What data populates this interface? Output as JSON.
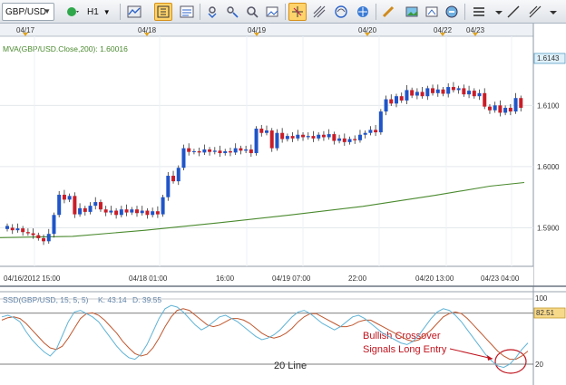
{
  "toolbar": {
    "symbol": "GBP/USD",
    "timeframe": "H1",
    "buttons": [
      "line-chart-icon",
      "bar-chart-icon",
      "candlestick-icon",
      "indicators-icon",
      "magnet-icon",
      "crosshair-icon",
      "cursor-icon",
      "pitchfork-icon",
      "fibonacci-icon",
      "gann-icon",
      "ruler-icon",
      "image-icon",
      "zoom-icon",
      "properties-icon",
      "layout-icon",
      "trend-line-icon",
      "channel-icon"
    ],
    "active_button": "cursor-icon"
  },
  "chart_data": {
    "type": "candlestick",
    "symbol": "GBP/USD",
    "top_date_labels": [
      "04/17",
      "04/18",
      "04/19",
      "04/20",
      "04/22",
      "04/23"
    ],
    "bottom_time_labels": [
      "04/16/2012 15:00",
      "04/18 01:00",
      "16:00",
      "04/19 07:00",
      "22:00",
      "04/20 13:00",
      "04/23 04:00"
    ],
    "price_ticks": [
      "1.6100",
      "1.6000",
      "1.5900"
    ],
    "last_price": "1.6143",
    "ylim": [
      1.584,
      1.621
    ],
    "ma_label": "MVA(GBP/USD.Close,200): 1.60016",
    "ma": [
      [
        0,
        1.5884
      ],
      [
        80,
        1.5886
      ],
      [
        160,
        1.5896
      ],
      [
        240,
        1.5908
      ],
      [
        320,
        1.5921
      ],
      [
        400,
        1.5935
      ],
      [
        480,
        1.5953
      ],
      [
        540,
        1.5968
      ],
      [
        578,
        1.5974
      ]
    ],
    "candles": [
      [
        1.5898,
        1.5903
      ],
      [
        1.59,
        1.5896
      ],
      [
        1.5896,
        1.5899
      ],
      [
        1.5899,
        1.5893
      ],
      [
        1.5893,
        1.5891
      ],
      [
        1.5891,
        1.5888
      ],
      [
        1.5888,
        1.5883
      ],
      [
        1.5883,
        1.5878
      ],
      [
        1.5878,
        1.589
      ],
      [
        1.589,
        1.5921
      ],
      [
        1.5921,
        1.5954
      ],
      [
        1.5954,
        1.5946
      ],
      [
        1.5946,
        1.5952
      ],
      [
        1.5952,
        1.5922
      ],
      [
        1.5922,
        1.5932
      ],
      [
        1.5932,
        1.5926
      ],
      [
        1.5926,
        1.5936
      ],
      [
        1.5936,
        1.5942
      ],
      [
        1.5942,
        1.593
      ],
      [
        1.593,
        1.5925
      ],
      [
        1.5925,
        1.5928
      ],
      [
        1.5928,
        1.5921
      ],
      [
        1.5921,
        1.593
      ],
      [
        1.593,
        1.5925
      ],
      [
        1.5925,
        1.593
      ],
      [
        1.593,
        1.5924
      ],
      [
        1.5924,
        1.5928
      ],
      [
        1.5928,
        1.5921
      ],
      [
        1.5921,
        1.5927
      ],
      [
        1.5927,
        1.5922
      ],
      [
        1.5922,
        1.595
      ],
      [
        1.595,
        1.5985
      ],
      [
        1.5985,
        1.5976
      ],
      [
        1.5976,
        1.5998
      ],
      [
        1.5998,
        1.603
      ],
      [
        1.603,
        1.6024
      ],
      [
        1.6024,
        1.6025
      ],
      [
        1.6025,
        1.6023
      ],
      [
        1.6023,
        1.6028
      ],
      [
        1.6028,
        1.6024
      ],
      [
        1.6024,
        1.6026
      ],
      [
        1.6026,
        1.6022
      ],
      [
        1.6022,
        1.6025
      ],
      [
        1.6025,
        1.6023
      ],
      [
        1.6023,
        1.603
      ],
      [
        1.603,
        1.6026
      ],
      [
        1.6026,
        1.6028
      ],
      [
        1.6028,
        1.6022
      ],
      [
        1.6022,
        1.6062
      ],
      [
        1.6062,
        1.6055
      ],
      [
        1.6055,
        1.6059
      ],
      [
        1.6059,
        1.603
      ],
      [
        1.603,
        1.6055
      ],
      [
        1.6055,
        1.6045
      ],
      [
        1.6045,
        1.605
      ],
      [
        1.605,
        1.6046
      ],
      [
        1.6046,
        1.6052
      ],
      [
        1.6052,
        1.6048
      ],
      [
        1.6048,
        1.605
      ],
      [
        1.605,
        1.6046
      ],
      [
        1.6046,
        1.6052
      ],
      [
        1.6052,
        1.6048
      ],
      [
        1.6048,
        1.6053
      ],
      [
        1.6053,
        1.6042
      ],
      [
        1.6042,
        1.6046
      ],
      [
        1.6046,
        1.604
      ],
      [
        1.604,
        1.6045
      ],
      [
        1.6045,
        1.6043
      ],
      [
        1.6043,
        1.6052
      ],
      [
        1.6052,
        1.6055
      ],
      [
        1.6055,
        1.606
      ],
      [
        1.606,
        1.6056
      ],
      [
        1.6056,
        1.609
      ],
      [
        1.609,
        1.611
      ],
      [
        1.611,
        1.6103
      ],
      [
        1.6103,
        1.6115
      ],
      [
        1.6115,
        1.6108
      ],
      [
        1.6108,
        1.6125
      ],
      [
        1.6125,
        1.6116
      ],
      [
        1.6116,
        1.6122
      ],
      [
        1.6122,
        1.6115
      ],
      [
        1.6115,
        1.6128
      ],
      [
        1.6128,
        1.612
      ],
      [
        1.612,
        1.6126
      ],
      [
        1.6126,
        1.6119
      ],
      [
        1.6119,
        1.613
      ],
      [
        1.613,
        1.6125
      ],
      [
        1.6125,
        1.6128
      ],
      [
        1.6128,
        1.6118
      ],
      [
        1.6118,
        1.6124
      ],
      [
        1.6124,
        1.6115
      ],
      [
        1.6115,
        1.612
      ],
      [
        1.612,
        1.6098
      ],
      [
        1.6098,
        1.6092
      ],
      [
        1.6092,
        1.61
      ],
      [
        1.61,
        1.6088
      ],
      [
        1.6088,
        1.6096
      ],
      [
        1.6096,
        1.609
      ],
      [
        1.609,
        1.6112
      ],
      [
        1.6112,
        1.6096
      ]
    ],
    "indicator": {
      "label": "SSD(GBP/USD, 15, 5, 5)",
      "k_label": "K: 43.14",
      "d_label": "D: 39.55",
      "top_scale": "100",
      "level_label": "82.51",
      "oversold_label": "20",
      "k_series": [
        78,
        80,
        77,
        72,
        60,
        50,
        42,
        35,
        30,
        38,
        55,
        72,
        84,
        86,
        82,
        78,
        72,
        62,
        52,
        42,
        34,
        28,
        26,
        32,
        44,
        60,
        76,
        88,
        92,
        90,
        84,
        76,
        68,
        62,
        66,
        72,
        78,
        80,
        76,
        72,
        66,
        60,
        54,
        50,
        52,
        56,
        62,
        70,
        78,
        84,
        86,
        82,
        76,
        70,
        66,
        62,
        66,
        72,
        78,
        80,
        76,
        70,
        64,
        58,
        54,
        50,
        46,
        44,
        48,
        56,
        66,
        76,
        84,
        88,
        86,
        80,
        72,
        62,
        52,
        42,
        32,
        24,
        18,
        16,
        20,
        28,
        38,
        46
      ],
      "d_series": [
        74,
        77,
        78,
        76,
        70,
        62,
        54,
        46,
        40,
        38,
        42,
        52,
        64,
        76,
        82,
        83,
        80,
        74,
        66,
        58,
        48,
        40,
        33,
        30,
        32,
        40,
        52,
        66,
        78,
        86,
        88,
        86,
        80,
        74,
        68,
        66,
        68,
        72,
        76,
        76,
        74,
        70,
        64,
        58,
        54,
        52,
        54,
        58,
        64,
        72,
        78,
        82,
        82,
        78,
        74,
        70,
        66,
        66,
        68,
        72,
        74,
        74,
        70,
        66,
        62,
        58,
        54,
        50,
        48,
        50,
        56,
        62,
        70,
        78,
        82,
        84,
        82,
        76,
        68,
        60,
        52,
        44,
        36,
        30,
        26,
        26,
        30,
        36
      ],
      "ylim": [
        0,
        100
      ],
      "levels": [
        100,
        82.51,
        20
      ]
    },
    "annotations": {
      "line_label": "20 Line",
      "note_line1": "Bullish Crossover",
      "note_line2": "Signals Long Entry"
    }
  },
  "colors": {
    "up": "#1f55c8",
    "down": "#c81e28",
    "ma": "#4a8a2e",
    "k": "#5fb3d6",
    "d": "#c0582f",
    "annotation": "#c0141e",
    "last_price_bg": "#dff1fb",
    "level_bg": "#f7d98a"
  }
}
